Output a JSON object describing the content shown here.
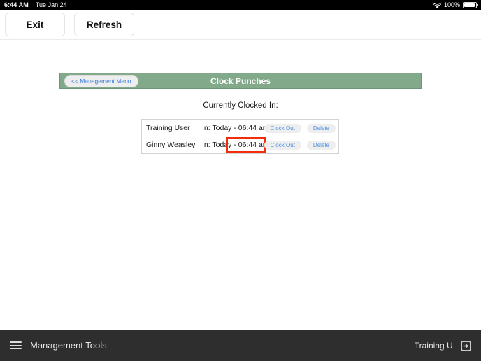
{
  "status_bar": {
    "time": "6:44 AM",
    "date": "Tue Jan 24",
    "wifi_icon": "wifi-icon",
    "battery_percent": "100%",
    "battery_icon": "battery-full-icon"
  },
  "toolbar": {
    "exit_label": "Exit",
    "refresh_label": "Refresh"
  },
  "header": {
    "back_label": "<< Management Menu",
    "title": "Clock Punches",
    "bar_color": "#81a98a"
  },
  "main": {
    "section_label": "Currently Clocked In:",
    "rows": [
      {
        "name": "Training User",
        "punch": "In: Today - 06:44 am",
        "clock_out_label": "Clock Out",
        "delete_label": "Delete"
      },
      {
        "name": "Ginny Weasley",
        "punch": "In: Today - 06:44 am",
        "clock_out_label": "Clock Out",
        "delete_label": "Delete"
      }
    ],
    "highlight": {
      "target_row": 1,
      "target_text": "06:44 am",
      "color": "#f22d0c"
    }
  },
  "bottom_bar": {
    "menu_icon": "hamburger-menu-icon",
    "menu_label": "Management Tools",
    "user_label": "Training U.",
    "logout_icon": "sign-out-icon"
  }
}
